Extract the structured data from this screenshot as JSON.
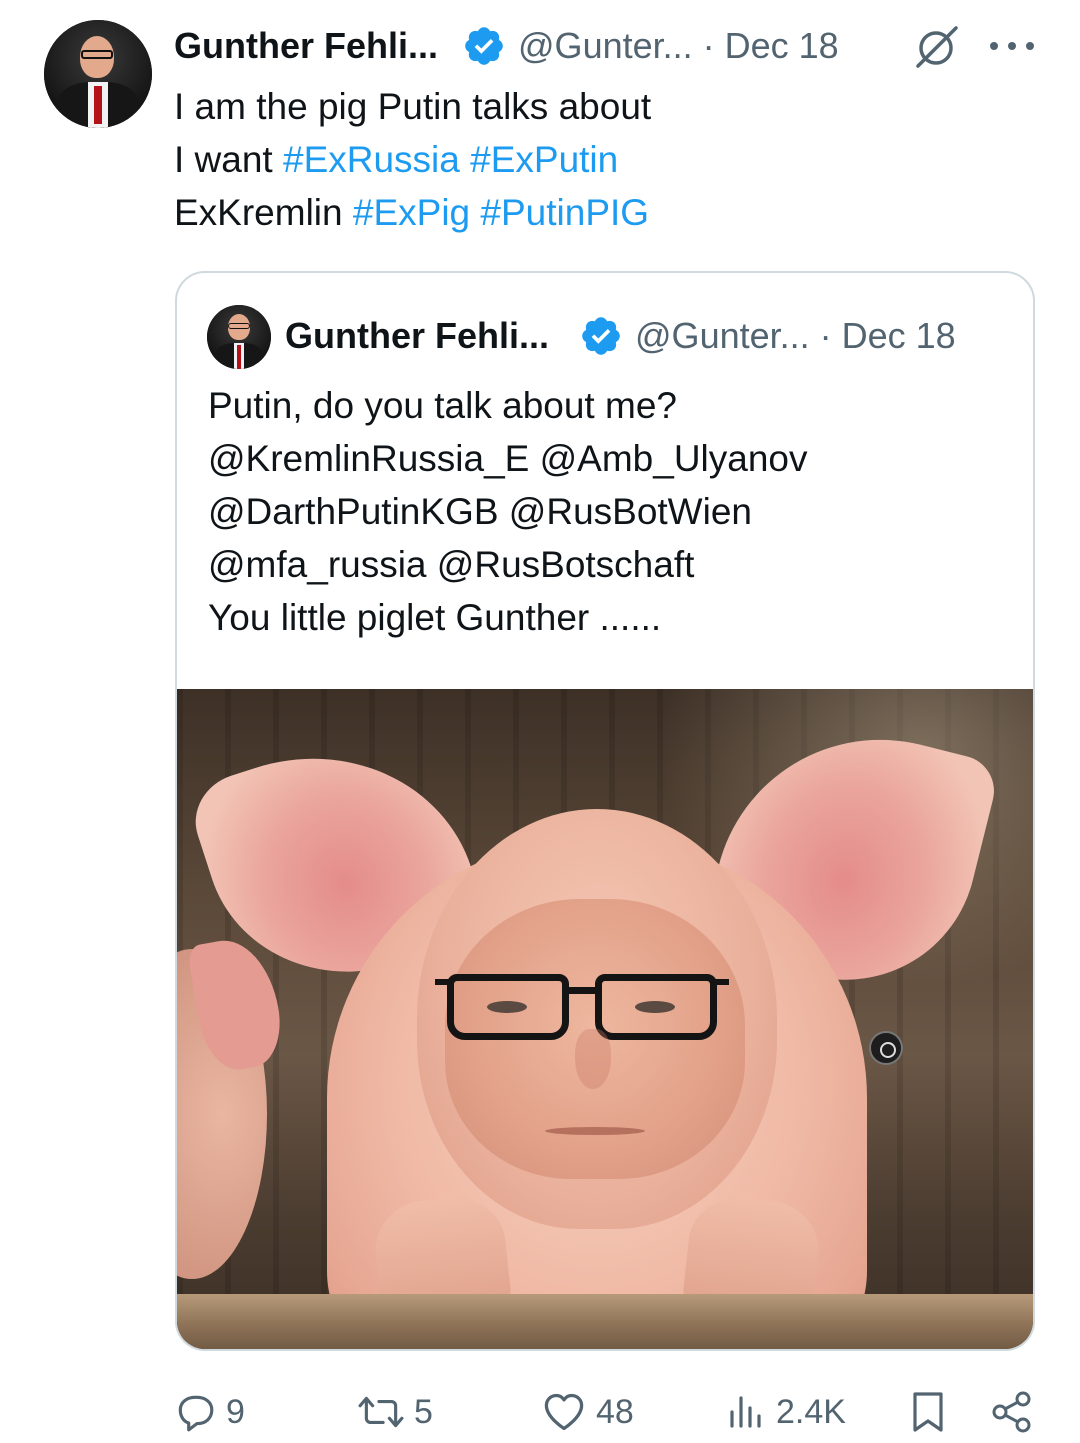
{
  "tweet": {
    "author_name": "Gunther Fehli...",
    "handle": "@Gunter...",
    "separator": "·",
    "date": "Dec 18",
    "text_lines": [
      [
        {
          "text": "I am the pig Putin talks about",
          "type": "text"
        }
      ],
      [
        {
          "text": "I want ",
          "type": "text"
        },
        {
          "text": "#ExRussia",
          "type": "hashtag"
        },
        {
          "text": " ",
          "type": "text"
        },
        {
          "text": "#ExPutin",
          "type": "hashtag"
        }
      ],
      [
        {
          "text": "ExKremlin ",
          "type": "text"
        },
        {
          "text": "#ExPig",
          "type": "hashtag"
        },
        {
          "text": " ",
          "type": "text"
        },
        {
          "text": "#PutinPIG",
          "type": "hashtag"
        }
      ]
    ]
  },
  "quoted_tweet": {
    "author_name": "Gunther Fehli...",
    "handle": "@Gunter...",
    "separator": "·",
    "date": "Dec 18",
    "text_lines": [
      "Putin, do you talk about me?",
      "@KremlinRussia_E @Amb_Ulyanov",
      "@DarthPutinKGB @RusBotWien",
      "@mfa_russia @RusBotschaft",
      "You little piglet Gunther ......"
    ]
  },
  "actions": {
    "replies": "9",
    "reposts": "5",
    "likes": "48",
    "views": "2.4K"
  },
  "icons": {
    "verified": "verified-badge-icon",
    "grok": "grok-icon",
    "more": "more-options-icon",
    "reply": "reply-icon",
    "repost": "repost-icon",
    "like": "like-icon",
    "views": "views-icon",
    "bookmark": "bookmark-icon",
    "share": "share-icon"
  },
  "colors": {
    "text": "#0f1419",
    "secondary": "#536471",
    "link": "#1d9bf0",
    "border": "#cfd9de"
  }
}
